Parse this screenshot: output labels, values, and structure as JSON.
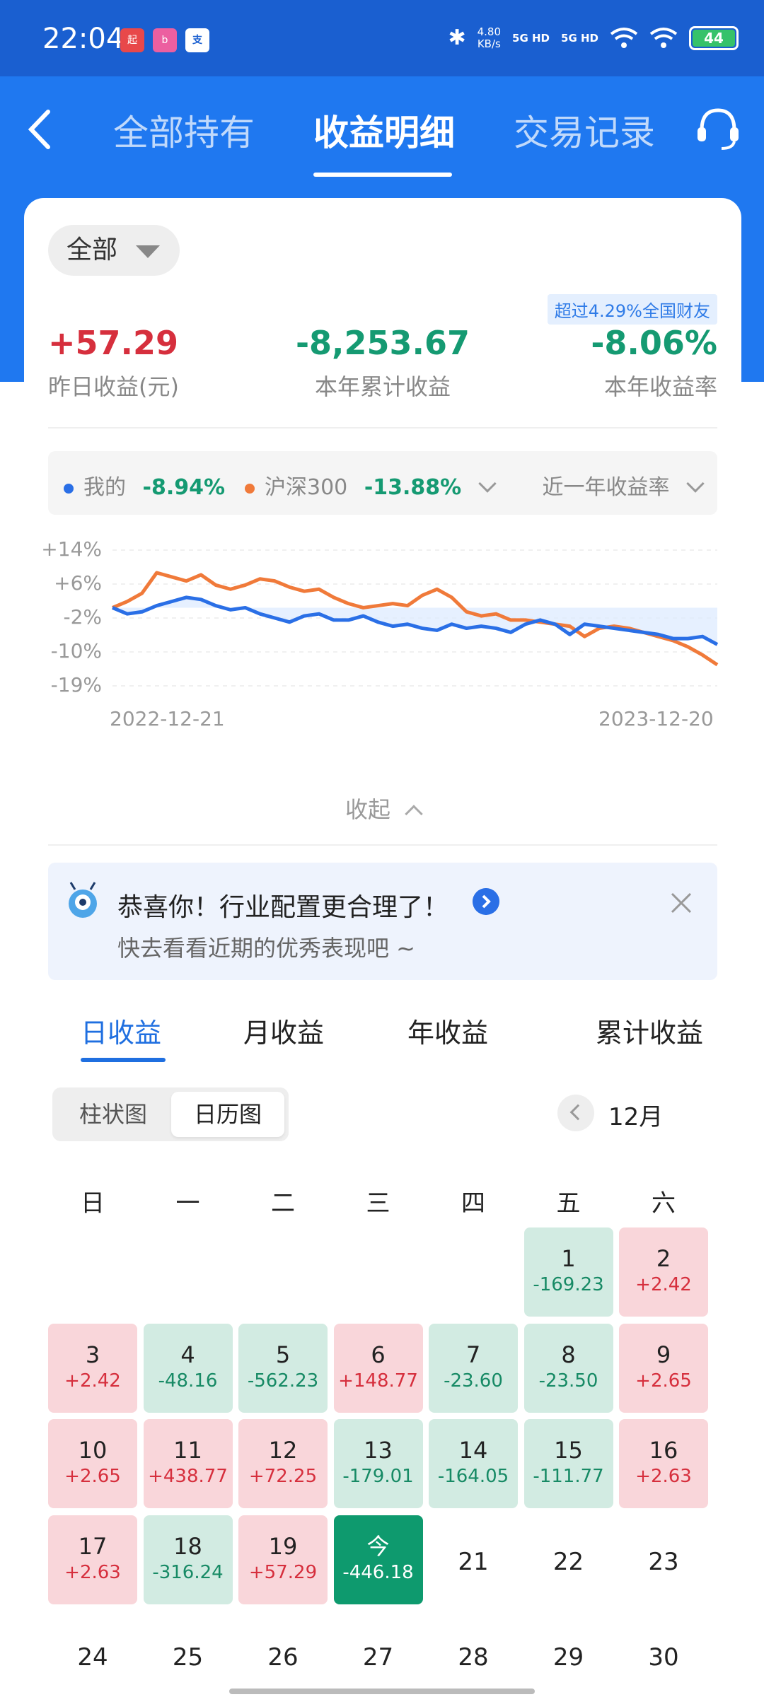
{
  "status_bar": {
    "time": "22:04",
    "net_speed": "4.80",
    "net_speed_unit": "KB/s",
    "sim1": "5G HD",
    "sim2": "5G HD",
    "battery": "44"
  },
  "header": {
    "tabs": [
      {
        "label": "全部持有"
      },
      {
        "label": "收益明细"
      },
      {
        "label": "交易记录"
      }
    ]
  },
  "filter": {
    "label": "全部"
  },
  "badge": "超过4.29%全国财友",
  "stats": {
    "yesterday": {
      "value": "+57.29",
      "label": "昨日收益(元)"
    },
    "year_total": {
      "value": "-8,253.67",
      "label": "本年累计收益"
    },
    "year_rate": {
      "value": "-8.06%",
      "label": "本年收益率"
    }
  },
  "legend": {
    "mine_label": "我的",
    "mine_value": "-8.94%",
    "index_label": "沪深300",
    "index_value": "-13.88%",
    "period_label": "近一年收益率"
  },
  "chart_data": {
    "type": "line",
    "y_ticks": [
      "+14%",
      "+6%",
      "-2%",
      "-10%",
      "-19%"
    ],
    "x_ticks": [
      "2022-12-21",
      "2023-12-20"
    ],
    "ylim": [
      -19,
      14
    ],
    "series": [
      {
        "name": "我的",
        "color": "#2a6fe6",
        "values": [
          0,
          -1.5,
          -1,
          0.5,
          1.5,
          2.5,
          2,
          0.5,
          -0.5,
          0,
          -1.5,
          -2.5,
          -3.5,
          -2,
          -1.5,
          -3,
          -3,
          -2,
          -3.5,
          -4.5,
          -4,
          -5,
          -5.5,
          -4,
          -5,
          -4.5,
          -5,
          -6,
          -4,
          -3,
          -4,
          -6.5,
          -4,
          -4.5,
          -5,
          -5.5,
          -6,
          -6.5,
          -7.5,
          -7.5,
          -7,
          -8.94
        ]
      },
      {
        "name": "沪深300",
        "color": "#f07a3a",
        "values": [
          0,
          1.5,
          3.5,
          8.5,
          7.5,
          6.5,
          8,
          5.5,
          4.5,
          5.5,
          7,
          6.5,
          5,
          4,
          4.5,
          2.5,
          1,
          0,
          0.5,
          1,
          0.5,
          3,
          4.5,
          2.5,
          -1,
          -2,
          -1.5,
          -3,
          -3,
          -3.5,
          -4,
          -4.5,
          -7,
          -5,
          -4.5,
          -5,
          -6,
          -7,
          -8,
          -9.5,
          -11.5,
          -13.88
        ]
      }
    ]
  },
  "collapse_label": "收起",
  "promo": {
    "title": "恭喜你！行业配置更合理了！",
    "subtitle": "快去看看近期的优秀表现吧 ~"
  },
  "period_tabs": [
    {
      "label": "日收益"
    },
    {
      "label": "月收益"
    },
    {
      "label": "年收益"
    },
    {
      "label": "累计收益"
    }
  ],
  "view_toggle": {
    "bar": "柱状图",
    "calendar": "日历图"
  },
  "month_label": "12月",
  "weekdays": [
    "日",
    "一",
    "二",
    "三",
    "四",
    "五",
    "六"
  ],
  "calendar": [
    {
      "day": "1",
      "value": "-169.23",
      "kind": "down"
    },
    {
      "day": "2",
      "value": "+2.42",
      "kind": "up"
    },
    {
      "day": "3",
      "value": "+2.42",
      "kind": "up"
    },
    {
      "day": "4",
      "value": "-48.16",
      "kind": "down"
    },
    {
      "day": "5",
      "value": "-562.23",
      "kind": "down"
    },
    {
      "day": "6",
      "value": "+148.77",
      "kind": "up"
    },
    {
      "day": "7",
      "value": "-23.60",
      "kind": "down"
    },
    {
      "day": "8",
      "value": "-23.50",
      "kind": "down"
    },
    {
      "day": "9",
      "value": "+2.65",
      "kind": "up"
    },
    {
      "day": "10",
      "value": "+2.65",
      "kind": "up"
    },
    {
      "day": "11",
      "value": "+438.77",
      "kind": "up"
    },
    {
      "day": "12",
      "value": "+72.25",
      "kind": "up"
    },
    {
      "day": "13",
      "value": "-179.01",
      "kind": "down"
    },
    {
      "day": "14",
      "value": "-164.05",
      "kind": "down"
    },
    {
      "day": "15",
      "value": "-111.77",
      "kind": "down"
    },
    {
      "day": "16",
      "value": "+2.63",
      "kind": "up"
    },
    {
      "day": "17",
      "value": "+2.63",
      "kind": "up"
    },
    {
      "day": "18",
      "value": "-316.24",
      "kind": "down"
    },
    {
      "day": "19",
      "value": "+57.29",
      "kind": "up"
    },
    {
      "day": "今",
      "value": "-446.18",
      "kind": "today"
    },
    {
      "day": "21",
      "value": "",
      "kind": "plain"
    },
    {
      "day": "22",
      "value": "",
      "kind": "plain"
    },
    {
      "day": "23",
      "value": "",
      "kind": "plain"
    },
    {
      "day": "24",
      "value": "",
      "kind": "plain"
    },
    {
      "day": "25",
      "value": "",
      "kind": "plain"
    },
    {
      "day": "26",
      "value": "",
      "kind": "plain"
    },
    {
      "day": "27",
      "value": "",
      "kind": "plain"
    },
    {
      "day": "28",
      "value": "",
      "kind": "plain"
    },
    {
      "day": "29",
      "value": "",
      "kind": "plain"
    },
    {
      "day": "30",
      "value": "",
      "kind": "plain"
    }
  ]
}
